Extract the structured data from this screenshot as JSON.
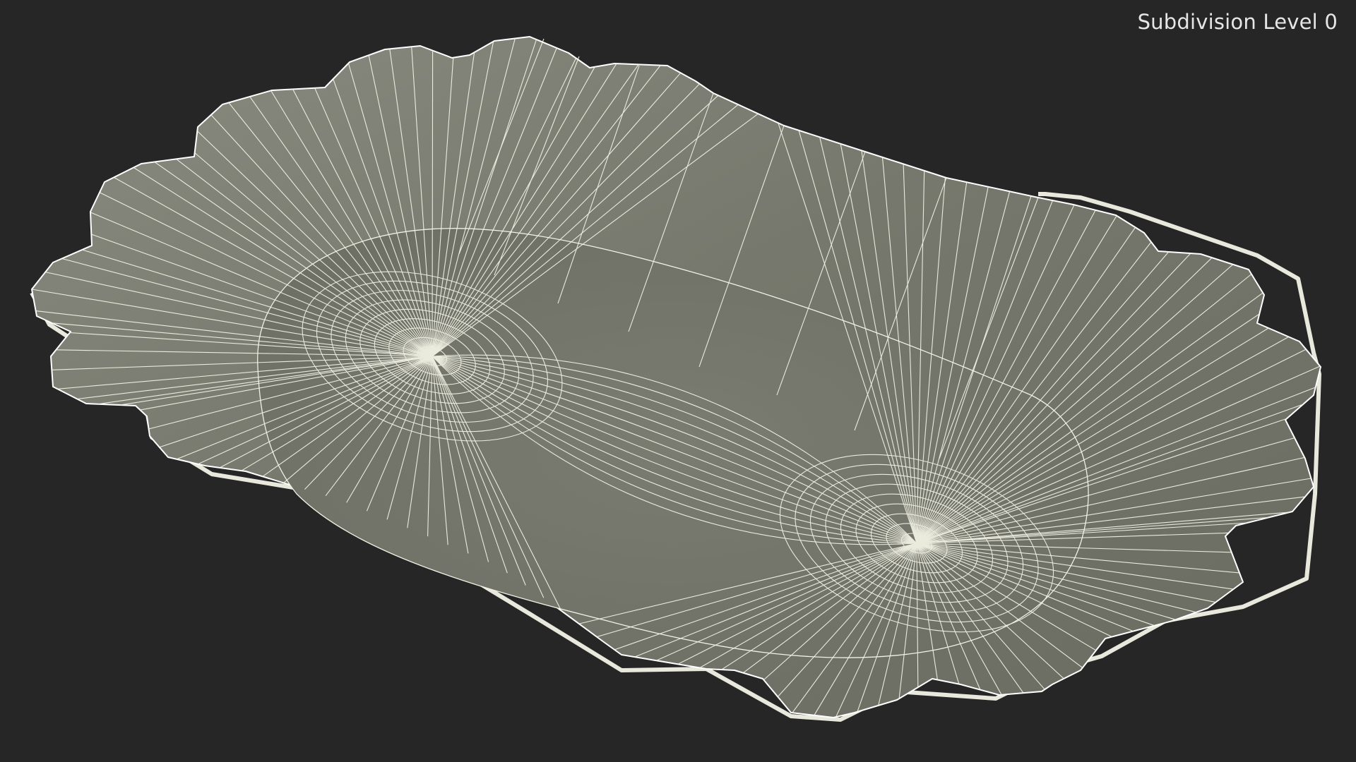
{
  "viewport": {
    "subdivision_label": "Subdivision Level 0",
    "background_color": "#262626",
    "surface_color": "#74766b",
    "wire_color": "#f1f1e4"
  },
  "model": {
    "name": "wavy-oval-paper-tray",
    "render_mode": "wireframe-on-shaded"
  }
}
